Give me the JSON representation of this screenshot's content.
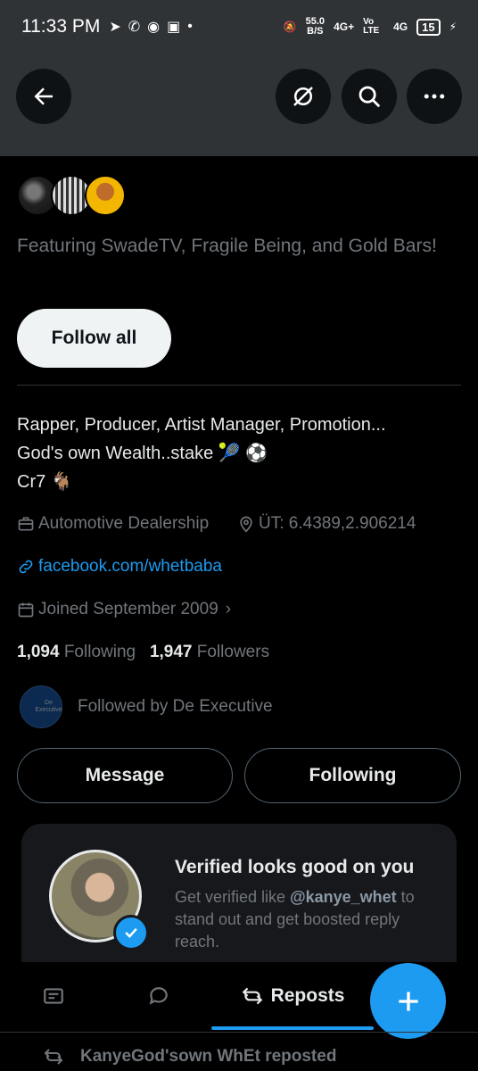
{
  "status_bar": {
    "time": "11:33 PM",
    "net_speed_value": "55.0",
    "net_speed_unit": "B/S",
    "signal_1": "4G+",
    "volte": "Vo LTE",
    "signal_2": "4G",
    "battery": "15"
  },
  "header": {
    "back_icon": "arrow-left-icon",
    "icons": [
      "hide-icon",
      "search-icon",
      "more-icon"
    ]
  },
  "profile": {
    "featuring_text": "Featuring SwadeTV, Fragile Being, and Gold Bars!",
    "follow_all_label": "Follow all",
    "bio_lines": [
      "Rapper, Producer, Artist Manager, Promotion...",
      "God's own Wealth..stake 🎾 ⚽",
      "Cr7 🐐"
    ],
    "category": "Automotive Dealership",
    "location": "ÜT: 6.4389,2.906214",
    "website": "facebook.com/whetbaba",
    "joined": "Joined September 2009",
    "following_count": "1,094",
    "following_label": "Following",
    "followers_count": "1,947",
    "followers_label": "Followers",
    "followed_by_text": "Followed by De Executive",
    "followed_by_avatar_label": "De Executive",
    "message_label": "Message",
    "following_button_label": "Following"
  },
  "verified_card": {
    "title": "Verified looks good on you",
    "text_before": "Get verified like ",
    "handle": "@kanye_whet",
    "text_after": " to stand out and get boosted reply reach."
  },
  "tabs": {
    "items": [
      "media-icon",
      "reply-icon",
      "repost-icon"
    ],
    "active_label": "Reposts"
  },
  "fab_icon": "plus-icon",
  "repost_line": {
    "text": "KanyeGod'sown WhEt reposted"
  },
  "colors": {
    "accent": "#1d9bf0",
    "background": "#000000",
    "header_bg": "#2f3336",
    "muted_text": "#71767b"
  }
}
